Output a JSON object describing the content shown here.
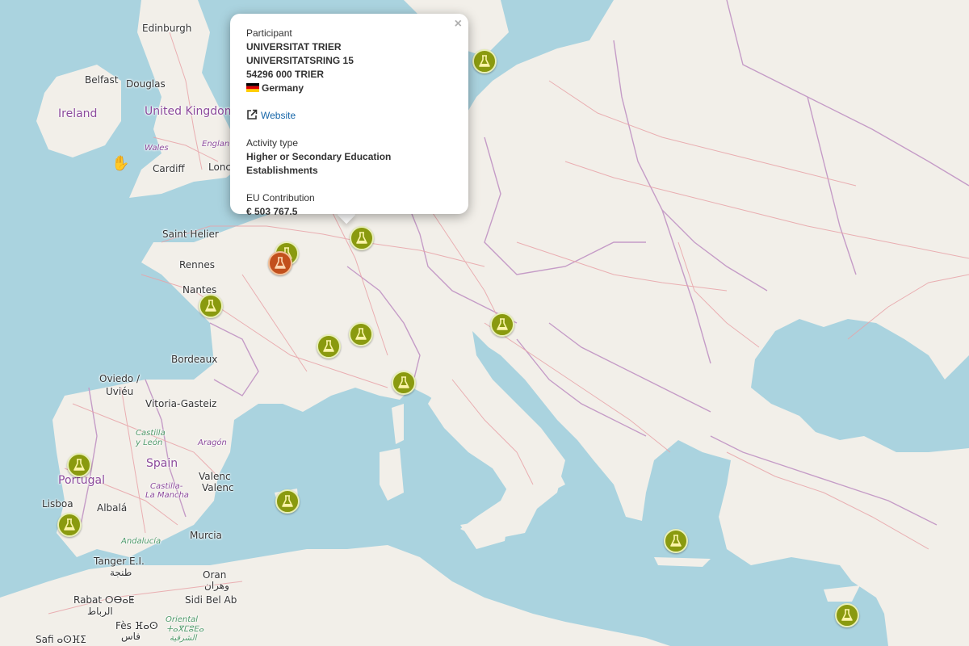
{
  "map": {
    "places": [
      {
        "name": "Edinburgh",
        "kind": "city"
      },
      {
        "name": "Belfast",
        "kind": "city"
      },
      {
        "name": "Douglas",
        "kind": "city"
      },
      {
        "name": "Ireland",
        "kind": "country"
      },
      {
        "name": "United Kingdom",
        "kind": "country"
      },
      {
        "name": "Wales",
        "kind": "region"
      },
      {
        "name": "Englan",
        "kind": "region"
      },
      {
        "name": "Cardiff",
        "kind": "city"
      },
      {
        "name": "Lonc",
        "kind": "city"
      },
      {
        "name": "Saint Helier",
        "kind": "city"
      },
      {
        "name": "Rennes",
        "kind": "city"
      },
      {
        "name": "Nantes",
        "kind": "city"
      },
      {
        "name": "Bordeaux",
        "kind": "city"
      },
      {
        "name": "Oviedo /",
        "kind": "city"
      },
      {
        "name": "Uviéu",
        "kind": "city"
      },
      {
        "name": "Vitoria-Gasteiz",
        "kind": "city"
      },
      {
        "name": "Castilla",
        "kind": "region"
      },
      {
        "name": "y León",
        "kind": "region"
      },
      {
        "name": "Aragón",
        "kind": "region"
      },
      {
        "name": "Spain",
        "kind": "country"
      },
      {
        "name": "Valenc",
        "kind": "city"
      },
      {
        "name": "Valenc",
        "kind": "city"
      },
      {
        "name": "Portugal",
        "kind": "country"
      },
      {
        "name": "Castilla-",
        "kind": "region"
      },
      {
        "name": "La Mancha",
        "kind": "region"
      },
      {
        "name": "Lisboa",
        "kind": "city"
      },
      {
        "name": "Albalá",
        "kind": "city"
      },
      {
        "name": "Andalucía",
        "kind": "region-green"
      },
      {
        "name": "Murcia",
        "kind": "city"
      },
      {
        "name": "Tanger ⴹ.ⵏ.",
        "kind": "city"
      },
      {
        "name": "طنجة",
        "kind": "city"
      },
      {
        "name": "Oran",
        "kind": "city"
      },
      {
        "name": "وهران",
        "kind": "city"
      },
      {
        "name": "Rabat ⵔⴱⴰⵟ",
        "kind": "city"
      },
      {
        "name": "الرباط",
        "kind": "city"
      },
      {
        "name": "Sidi Bel Ab",
        "kind": "city"
      },
      {
        "name": "Oriental",
        "kind": "region-green"
      },
      {
        "name": "ⵜⴰⴳⵎⵓⴹⴰ",
        "kind": "region-green"
      },
      {
        "name": "الشرقية",
        "kind": "region-green"
      },
      {
        "name": "Fès ⴼⴰⵙ",
        "kind": "city"
      },
      {
        "name": "فاس",
        "kind": "city"
      },
      {
        "name": "Safi ⴰⵙⴼⵉ",
        "kind": "city"
      }
    ],
    "colors": {
      "sea": "#aad3df",
      "land": "#f2efe9",
      "marker": "#8a9a0f",
      "marker_selected": "#c2501c",
      "road": "#e8a3a8",
      "border": "#c59cc7"
    },
    "marker_icon": "flask-icon"
  },
  "popup": {
    "close_label": "×",
    "participant_label": "Participant",
    "name": "UNIVERSITAT TRIER",
    "street": "UNIVERSITATSRING 15",
    "city": "54296 000 TRIER",
    "country": "Germany",
    "website_label": "Website",
    "activity_type_label": "Activity type",
    "activity_type": "Higher or Secondary Education Establishments",
    "contribution_label": "EU Contribution",
    "contribution": "€ 503 767.5"
  }
}
